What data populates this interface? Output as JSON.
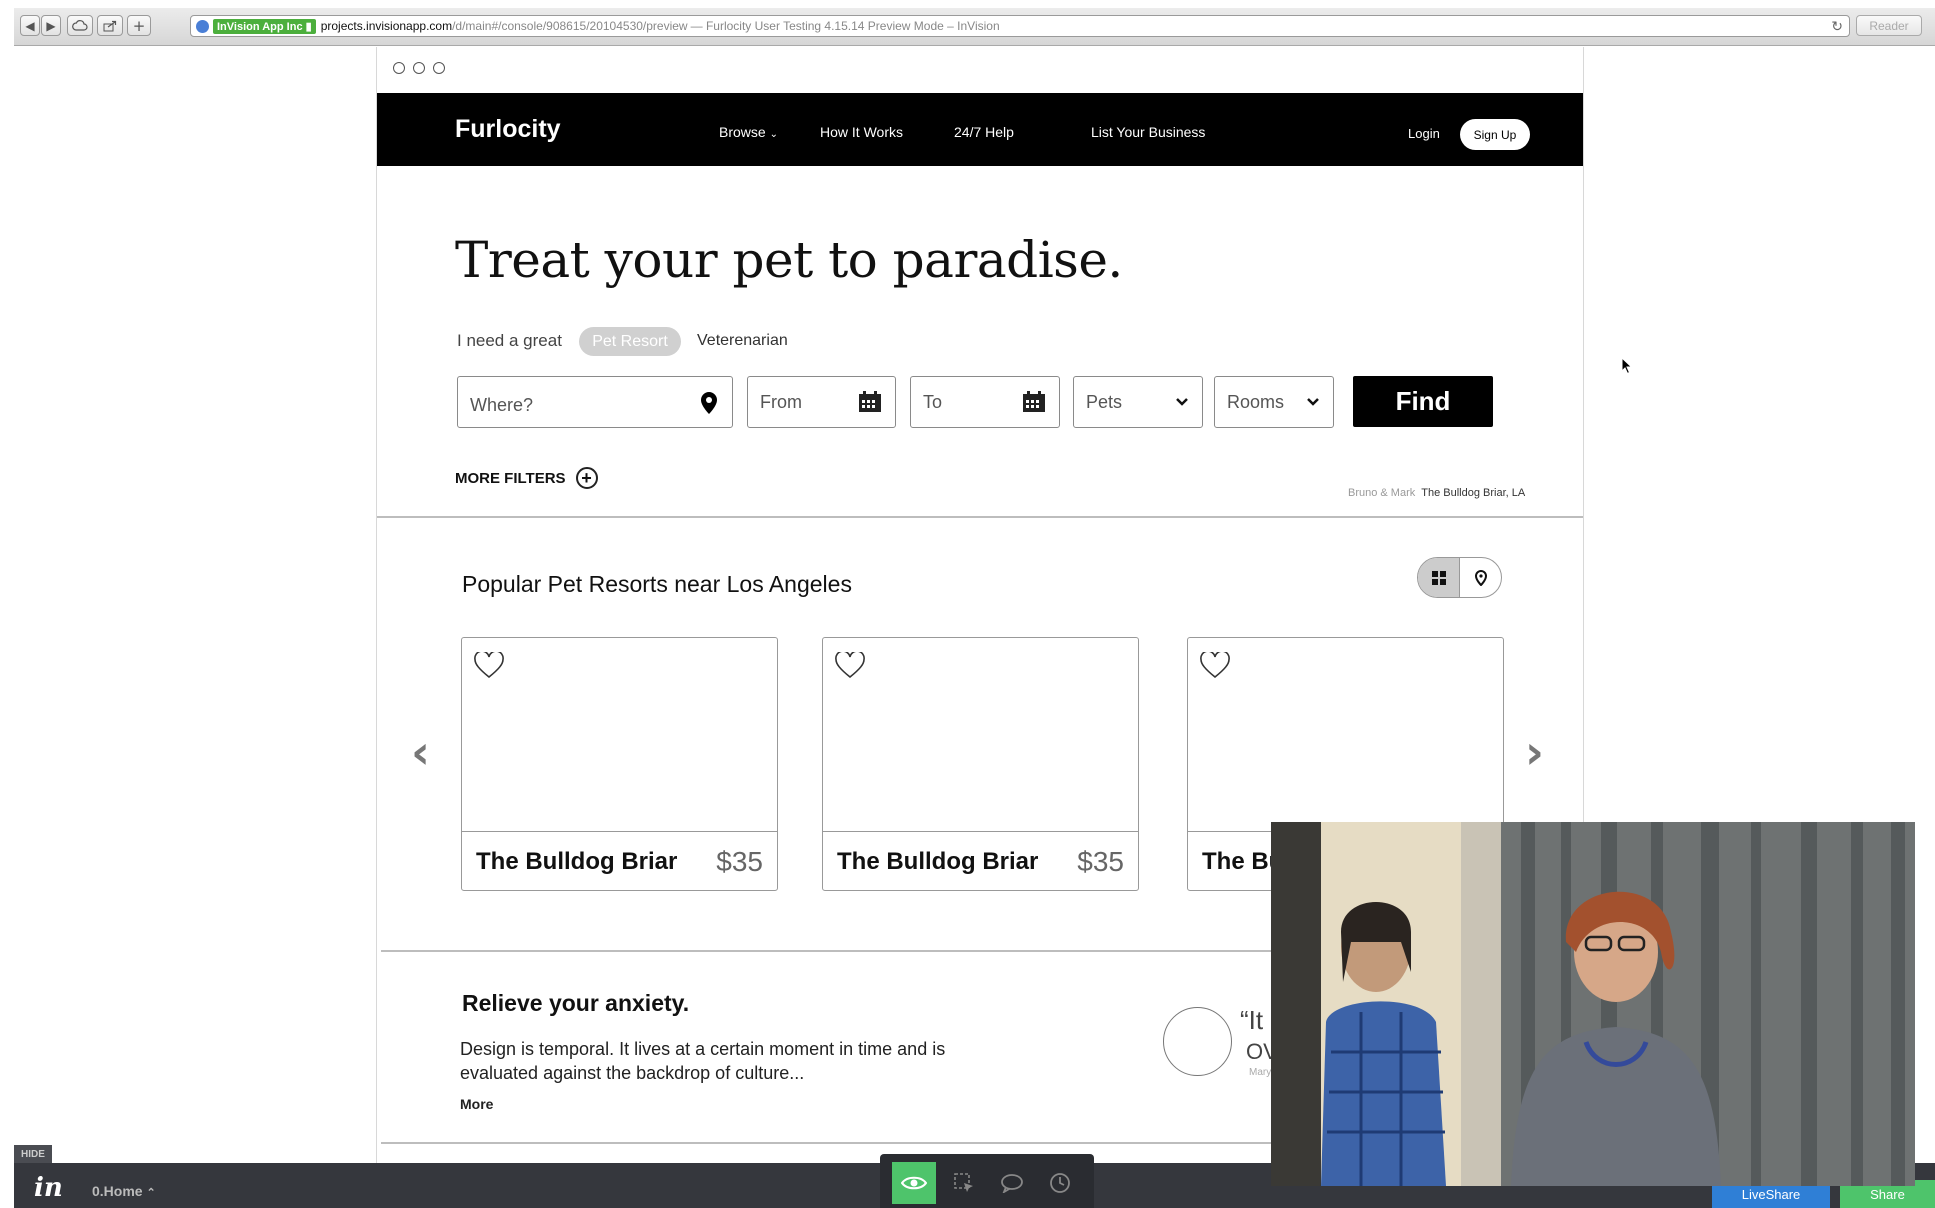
{
  "browser": {
    "cert_label": "InVision App Inc",
    "url_host": "projects.invisionapp.com",
    "url_path": "/d/main#/console/908615/20104530/preview",
    "page_title": "— Furlocity User Testing 4.15.14 Preview Mode – InVision",
    "reader_label": "Reader"
  },
  "nav": {
    "logo": "Furlocity",
    "browse": "Browse",
    "how_it_works": "How It Works",
    "help": "24/7 Help",
    "list_business": "List Your Business",
    "login": "Login",
    "signup": "Sign Up"
  },
  "hero": {
    "title": "Treat your pet to paradise.",
    "need_text": "I need a great",
    "option_selected": "Pet Resort",
    "option_other": "Veterenarian"
  },
  "search": {
    "where_placeholder": "Where?",
    "from_placeholder": "From",
    "to_placeholder": "To",
    "pets_label": "Pets",
    "rooms_label": "Rooms",
    "find_label": "Find",
    "more_filters": "MORE FILTERS"
  },
  "photo_credit": {
    "owner": "Bruno & Mark",
    "place": "The Bulldog Briar, LA"
  },
  "popular": {
    "heading": "Popular Pet Resorts near Los Angeles",
    "cards": [
      {
        "name": "The Bulldog Briar",
        "price": "$35"
      },
      {
        "name": "The Bulldog Briar",
        "price": "$35"
      },
      {
        "name": "The Bu",
        "price": ""
      }
    ]
  },
  "relieve": {
    "heading": "Relieve your anxiety.",
    "body": "Design is temporal. It lives at a certain moment in time and is evaluated against the backdrop of culture...",
    "more": "More",
    "quote_line1": "“It",
    "quote_line2": "OV",
    "quote_author": "Mary"
  },
  "invision_bar": {
    "hide": "HIDE",
    "screen_name": "0.Home",
    "liveshare": "LiveShare",
    "share": "Share",
    "active_tool": "preview-eye",
    "accent_green": "#4ec46b"
  }
}
